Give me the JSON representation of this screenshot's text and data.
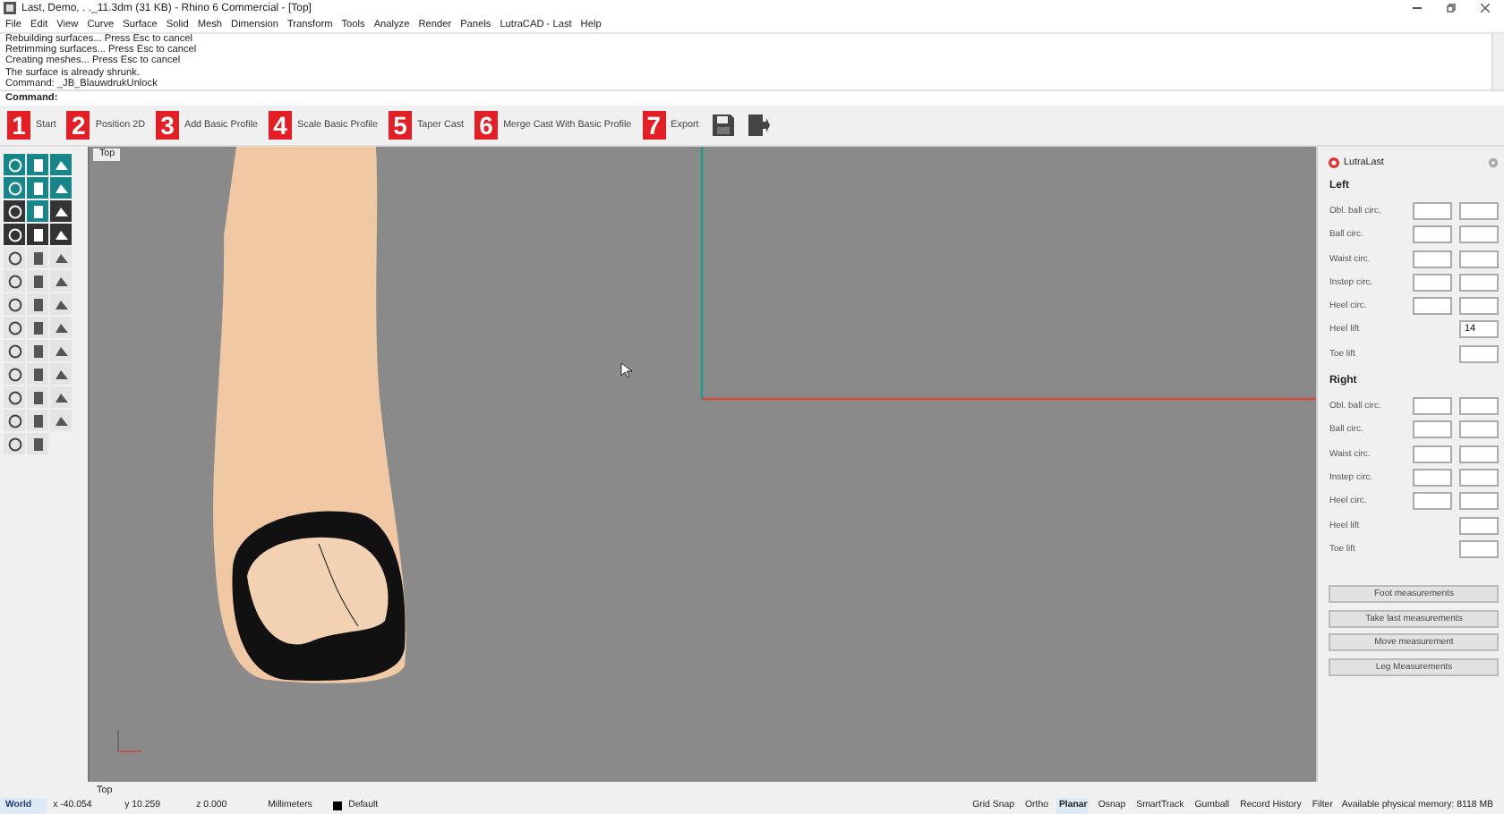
{
  "window": {
    "title": "Last, Demo, . ._11.3dm (31 KB) - Rhino 6 Commercial - [Top]"
  },
  "menu": [
    "File",
    "Edit",
    "View",
    "Curve",
    "Surface",
    "Solid",
    "Mesh",
    "Dimension",
    "Transform",
    "Tools",
    "Analyze",
    "Render",
    "Panels",
    "LutraCAD - Last",
    "Help"
  ],
  "command_history": [
    "Rebuilding surfaces... Press Esc to cancel",
    "Retrimming surfaces... Press Esc to cancel",
    "Creating meshes... Press Esc to cancel",
    "The surface is already shrunk.",
    "Command: _JB_BlauwdrukUnlock"
  ],
  "command_prompt": "Command:",
  "steps": [
    {
      "number": "1",
      "label": "Start"
    },
    {
      "number": "2",
      "label": "Position 2D"
    },
    {
      "number": "3",
      "label": "Add Basic Profile"
    },
    {
      "number": "4",
      "label": "Scale Basic Profile"
    },
    {
      "number": "5",
      "label": "Taper Cast"
    },
    {
      "number": "6",
      "label": "Merge Cast With Basic Profile"
    },
    {
      "number": "7",
      "label": "Export"
    }
  ],
  "viewport": {
    "label": "Top"
  },
  "panel": {
    "title": "LutraLast",
    "sections": [
      {
        "heading": "Left",
        "rows": [
          {
            "label": "Obl. ball circ.",
            "kind": "pair"
          },
          {
            "label": "Ball circ.",
            "kind": "pair"
          },
          {
            "label": "Waist circ.",
            "kind": "pair"
          },
          {
            "label": "Instep circ.",
            "kind": "pair"
          },
          {
            "label": "Heel circ.",
            "kind": "pair"
          },
          {
            "label": "Heel lift",
            "kind": "single",
            "value": "14"
          },
          {
            "label": "Toe lift",
            "kind": "single"
          }
        ]
      },
      {
        "heading": "Right",
        "rows": [
          {
            "label": "Obl. ball circ.",
            "kind": "pair"
          },
          {
            "label": "Ball circ.",
            "kind": "pair"
          },
          {
            "label": "Waist circ.",
            "kind": "pair"
          },
          {
            "label": "Instep circ.",
            "kind": "pair"
          },
          {
            "label": "Heel circ.",
            "kind": "pair"
          },
          {
            "label": "Heel lift",
            "kind": "single"
          },
          {
            "label": "Toe lift",
            "kind": "single"
          }
        ]
      }
    ],
    "buttons": [
      "Foot measurements",
      "Take last measurements",
      "Move measurement",
      "Leg Measurements"
    ]
  },
  "viewport_tab": "Top",
  "status_bar": {
    "cplane": "World",
    "x": "x -40.054",
    "y": "y 10.259",
    "z": "z 0.000",
    "units": "Millimeters",
    "layer": "Default",
    "toggles": [
      {
        "label": "Grid Snap",
        "on": false
      },
      {
        "label": "Ortho",
        "on": false
      },
      {
        "label": "Planar",
        "on": true
      },
      {
        "label": "Osnap",
        "on": false
      },
      {
        "label": "SmartTrack",
        "on": false
      },
      {
        "label": "Gumball",
        "on": false
      },
      {
        "label": "Record History",
        "on": false
      },
      {
        "label": "Filter",
        "on": false
      }
    ],
    "memory": "Available physical memory: 8118 MB"
  }
}
